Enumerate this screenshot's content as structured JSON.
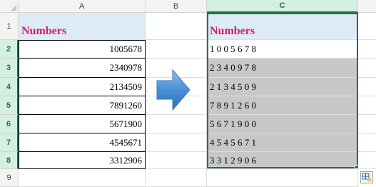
{
  "columns": {
    "a": "A",
    "b": "B",
    "c": "C"
  },
  "rows": [
    "1",
    "2",
    "3",
    "4",
    "5",
    "6",
    "7",
    "8",
    "9"
  ],
  "header_text": "Numbers",
  "original_values": [
    "1005678",
    "2340978",
    "2134509",
    "7891260",
    "5671900",
    "4545671",
    "3312906"
  ],
  "spaced_values": [
    "1 0 0 5 6 7 8",
    "2 3 4 0 9 7 8",
    "2 1 3 4 5 0 9",
    "7 8 9 1 2 6 0",
    "5 6 7 1 9 0 0",
    "4 5 4 5 6 7 1",
    "3 3 1 2 9 0 6"
  ],
  "icons": {
    "arrow": "right-arrow-icon",
    "quick_analysis": "quick-analysis-icon"
  },
  "colors": {
    "header_fill": "#ddebf7",
    "header_text": "#cc1f6b",
    "selection": "#217346",
    "result_fill": "#c8c8c8"
  }
}
